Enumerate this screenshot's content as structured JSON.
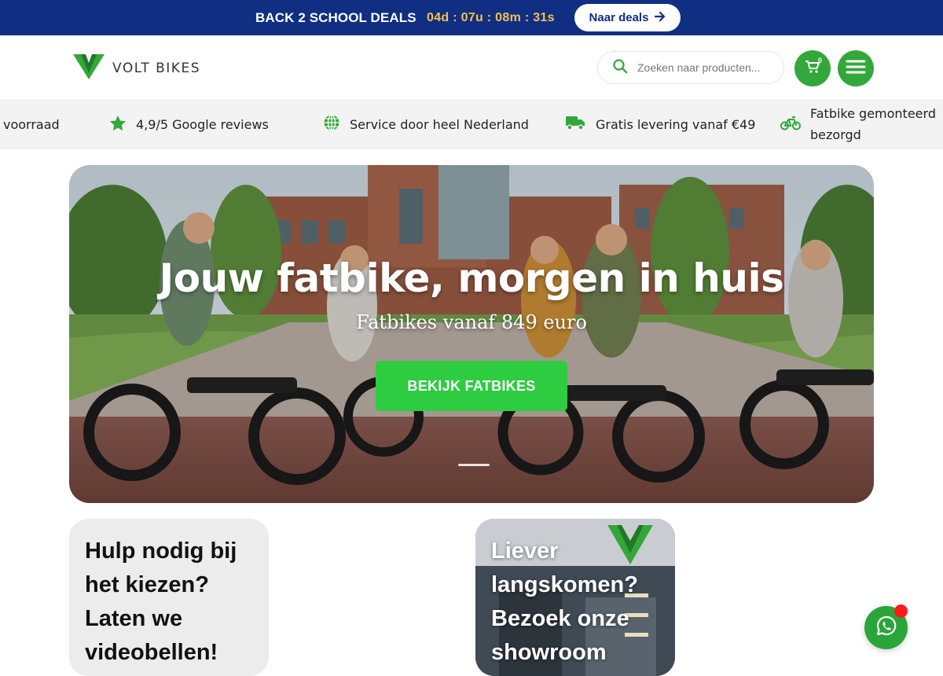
{
  "colors": {
    "promo_bg": "#102f83",
    "timer": "#f5c14b",
    "brand_green": "#33a83a",
    "cta_green": "#2ecc40",
    "usp_bg": "#f3f3f3"
  },
  "promo": {
    "title": "BACK 2 SCHOOL DEALS",
    "timer": "04d : 07u : 08m : 31s",
    "button_label": "Naar deals",
    "button_icon": "arrow-right-icon"
  },
  "header": {
    "logo_text": "VOLT BIKES",
    "search_placeholder": "Zoeken naar producten...",
    "cart_count": "0",
    "cart_icon": "cart-icon",
    "menu_icon": "hamburger-icon"
  },
  "usp": {
    "items": [
      {
        "icon": "none",
        "text": "voorraad"
      },
      {
        "icon": "star-icon",
        "text": "4,9/5 Google reviews"
      },
      {
        "icon": "globe-icon",
        "text": "Service door heel Nederland"
      },
      {
        "icon": "truck-icon",
        "text": "Gratis levering vanaf €49"
      },
      {
        "icon": "bike-icon",
        "text": "Fatbike gemonteerd bezorgd"
      }
    ]
  },
  "hero": {
    "title": "Jouw fatbike, morgen in huis",
    "subtitle": "Fatbikes vanaf 849 euro",
    "cta_label": "BEKIJK FATBIKES"
  },
  "cards": {
    "help_text": "Hulp nodig bij het kiezen? Laten we videobellen!",
    "showroom_text": "Liever langskomen? Bezoek onze showroom"
  },
  "whatsapp": {
    "icon": "whatsapp-icon"
  }
}
